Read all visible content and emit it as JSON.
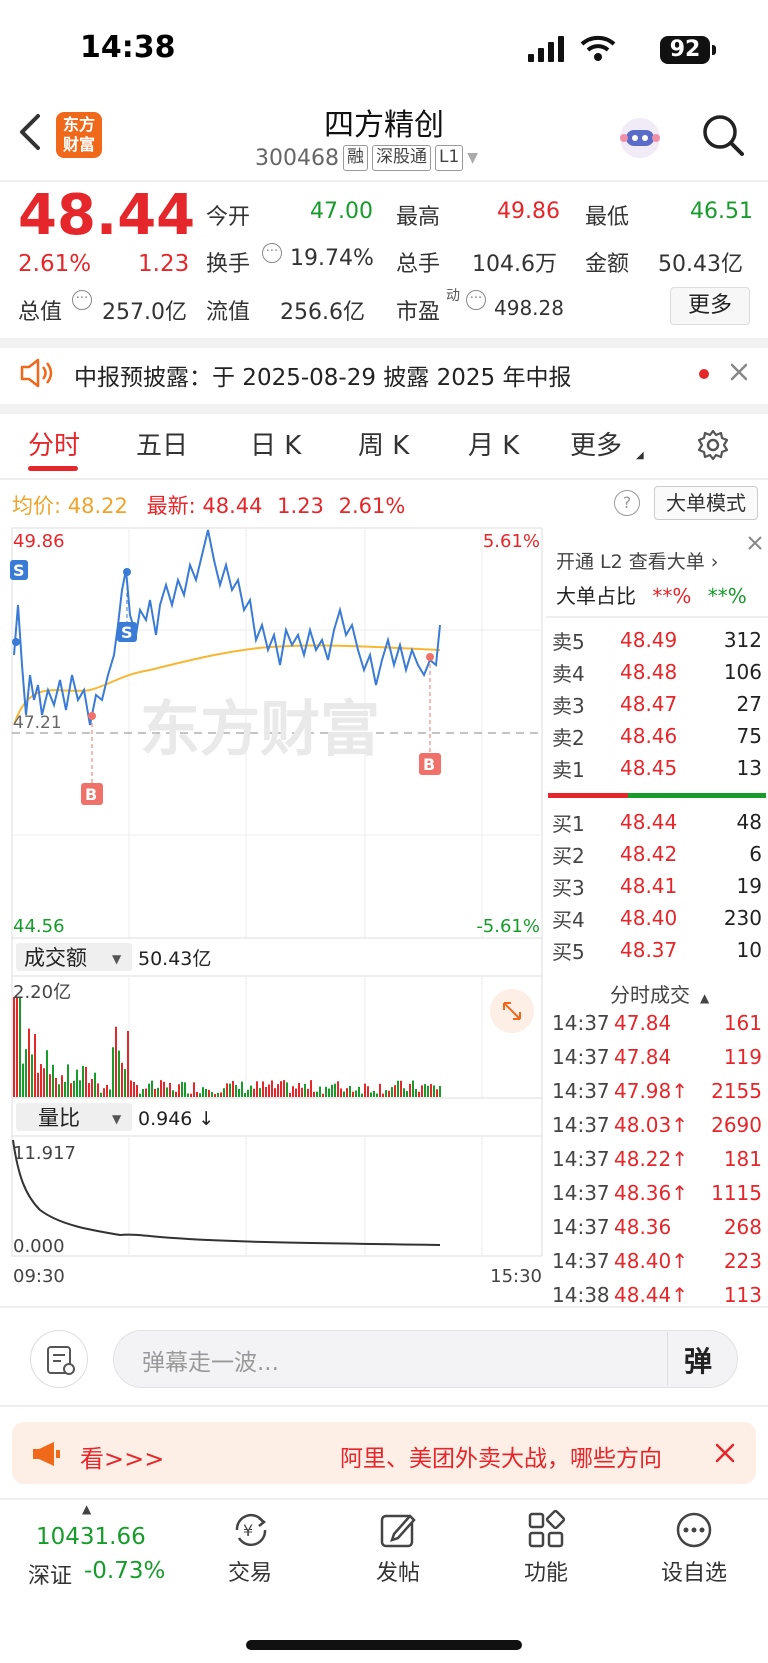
{
  "status": {
    "time": "14:38",
    "battery": "92"
  },
  "header": {
    "logo_line1": "东方",
    "logo_line2": "财富",
    "name": "四方精创",
    "code": "300468",
    "tags": [
      "融",
      "深股通",
      "L1"
    ]
  },
  "quote": {
    "price": "48.44",
    "pct": "2.61%",
    "change": "1.23",
    "open_label": "今开",
    "open": "47.00",
    "high_label": "最高",
    "high": "49.86",
    "low_label": "最低",
    "low": "46.51",
    "turnover_label": "换手",
    "turnover": "19.74%",
    "volume_label": "总手",
    "volume": "104.6万",
    "amount_label": "金额",
    "amount": "50.43亿",
    "mktcap_label": "总值",
    "mktcap": "257.0亿",
    "float_label": "流值",
    "float": "256.6亿",
    "pe_label": "市盈",
    "pe_sup": "动",
    "pe": "498.28",
    "more": "更多"
  },
  "notice": {
    "text": "中报预披露：于 2025-08-29 披露 2025 年中报"
  },
  "tabs": [
    "分时",
    "五日",
    "日 K",
    "周 K",
    "月 K",
    "更多"
  ],
  "avg_bar": {
    "avg_label": "均价:",
    "avg": "48.22",
    "last_label": "最新:",
    "last": "48.44",
    "chg": "1.23",
    "pct": "2.61%",
    "mode": "大单模式"
  },
  "chart": {
    "y_high": "49.86",
    "y_low": "44.56",
    "pct_high": "5.61%",
    "pct_low": "-5.61%",
    "prev_close": "47.21",
    "watermark": "东方财富",
    "turnover_label": "成交额",
    "turnover_value": "50.43亿",
    "vol_max": "2.20亿",
    "ratio_label": "量比",
    "ratio_value": "0.946 ↓",
    "ratio_max": "11.917",
    "ratio_min": "0.000",
    "t_start": "09:30",
    "t_end": "15:30",
    "markers": [
      "S",
      "S",
      "B",
      "B"
    ]
  },
  "l2": {
    "title": "开通 L2 查看大单 ›",
    "ratio_label": "大单占比",
    "red": "**%",
    "green": "**%"
  },
  "order_book": {
    "asks": [
      {
        "label": "卖5",
        "price": "48.49",
        "vol": "312"
      },
      {
        "label": "卖4",
        "price": "48.48",
        "vol": "106"
      },
      {
        "label": "卖3",
        "price": "48.47",
        "vol": "27"
      },
      {
        "label": "卖2",
        "price": "48.46",
        "vol": "75"
      },
      {
        "label": "卖1",
        "price": "48.45",
        "vol": "13"
      }
    ],
    "bids": [
      {
        "label": "买1",
        "price": "48.44",
        "vol": "48"
      },
      {
        "label": "买2",
        "price": "48.42",
        "vol": "6"
      },
      {
        "label": "买3",
        "price": "48.41",
        "vol": "19"
      },
      {
        "label": "买4",
        "price": "48.40",
        "vol": "230"
      },
      {
        "label": "买5",
        "price": "48.37",
        "vol": "10"
      }
    ]
  },
  "trades": {
    "title": "分时成交",
    "rows": [
      {
        "time": "14:37",
        "price": "47.84",
        "vol": "161"
      },
      {
        "time": "14:37",
        "price": "47.84",
        "vol": "119"
      },
      {
        "time": "14:37",
        "price": "47.98↑",
        "vol": "2155"
      },
      {
        "time": "14:37",
        "price": "48.03↑",
        "vol": "2690"
      },
      {
        "time": "14:37",
        "price": "48.22↑",
        "vol": "181"
      },
      {
        "time": "14:37",
        "price": "48.36↑",
        "vol": "1115"
      },
      {
        "time": "14:37",
        "price": "48.36",
        "vol": "268"
      },
      {
        "time": "14:37",
        "price": "48.40↑",
        "vol": "223"
      },
      {
        "time": "14:38",
        "price": "48.44↑",
        "vol": "113"
      }
    ]
  },
  "comment": {
    "placeholder": "弹幕走一波...",
    "danmu": "弹"
  },
  "ad": {
    "left": "看>>>",
    "right": "阿里、美团外卖大战，哪些方向"
  },
  "bottom_nav": {
    "index_value": "10431.66",
    "index_name": "深证",
    "index_pct": "-0.73%",
    "items": [
      "交易",
      "发帖",
      "功能",
      "设自选"
    ]
  },
  "colors": {
    "up": "#e5262a",
    "down": "#179c2c",
    "accent": "#f0681a",
    "price_line": "#3a7bd5",
    "avg_line": "#f7b733"
  }
}
